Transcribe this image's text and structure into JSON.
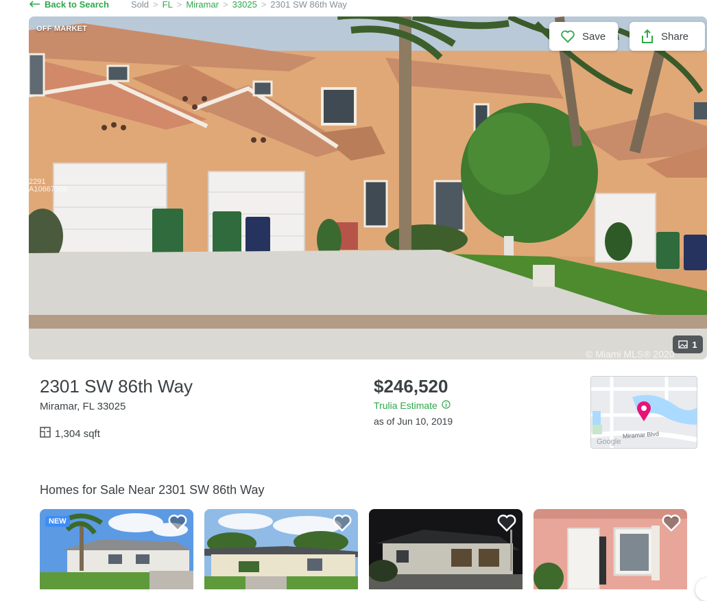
{
  "nav": {
    "back_label": "Back to Search",
    "breadcrumbs": [
      {
        "label": "Sold",
        "link": false
      },
      {
        "label": "FL",
        "link": true
      },
      {
        "label": "Miramar",
        "link": true
      },
      {
        "label": "33025",
        "link": true
      },
      {
        "label": "2301 SW 86th Way",
        "link": false
      }
    ],
    "separator": ">"
  },
  "hero": {
    "status_badge": "OFF MARKET",
    "save_label": "Save",
    "share_label": "Share",
    "photo_count": "1",
    "watermark": "© Miami MLS® 2020",
    "mls_tag_line1": "2291",
    "mls_tag_line2": "A10667500"
  },
  "listing": {
    "address": "2301 SW 86th Way",
    "city_state_zip": "Miramar, FL 33025",
    "sqft": "1,304 sqft",
    "price": "$246,520",
    "estimate_label": "Trulia Estimate",
    "as_of": "as of Jun 10, 2019"
  },
  "map": {
    "street_label": "Miramar Blvd",
    "provider": "Google"
  },
  "nearby": {
    "title": "Homes for Sale Near 2301 SW 86th Way",
    "cards": [
      {
        "badge": "NEW"
      },
      {
        "badge": ""
      },
      {
        "badge": ""
      },
      {
        "badge": ""
      }
    ]
  },
  "colors": {
    "brand_green": "#2ea84a",
    "text_dark": "#3b4144",
    "badge_blue": "#3f8cf4",
    "map_pin": "#e8137a"
  }
}
